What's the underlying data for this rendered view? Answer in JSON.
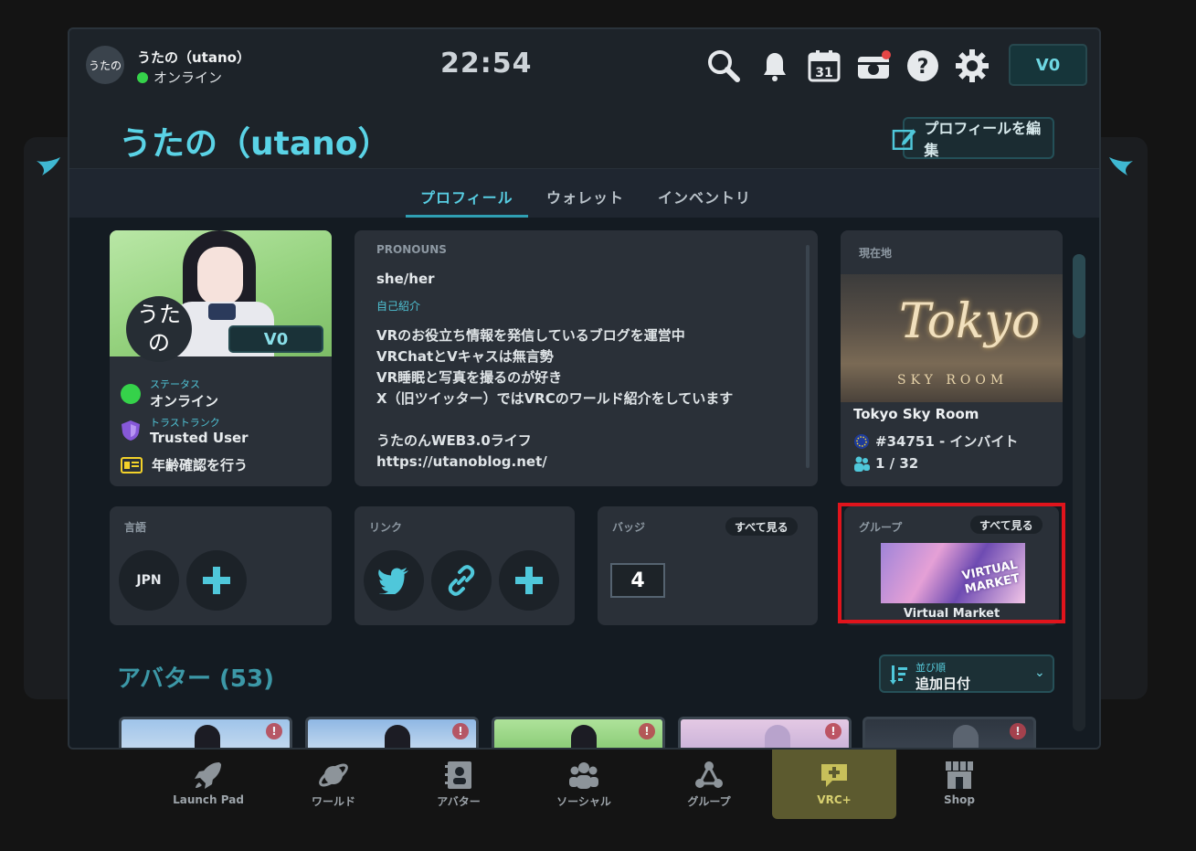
{
  "topbar": {
    "avatar_text": "うたの",
    "user_name": "うたの（utano）",
    "status": "オンライン",
    "clock": "22:54",
    "wallet": "V0",
    "calendar_day": "31"
  },
  "page": {
    "title": "うたの（utano）",
    "edit_label": "プロフィールを編集",
    "tabs": [
      "プロフィール",
      "ウォレット",
      "インベントリ"
    ]
  },
  "profile_card": {
    "avatar_text": "うた\nの",
    "vbadge": "V0",
    "status_label": "ステータス",
    "status_value": "オンライン",
    "trust_label": "トラストランク",
    "trust_value": "Trusted User",
    "age_verify": "年齢確認を行う"
  },
  "bio": {
    "pronouns_label": "PRONOUNS",
    "pronouns": "she/her",
    "intro_label": "自己紹介",
    "lines": [
      "VRのお役立ち情報を発信しているブログを運営中",
      "VRChatとVキャスは無言勢",
      "VR睡眠と写真を撮るのが好き",
      "X（旧ツイッター）ではVRCのワールド紹介をしています",
      "",
      "うたのんWEB3.0ライフ",
      "https://utanoblog.net/"
    ]
  },
  "location": {
    "label": "現在地",
    "world_title_1": "Tokyo",
    "world_title_2": "SKY ROOM",
    "world_name": "Tokyo Sky Room",
    "instance": "#34751 - インバイト",
    "players": "1 / 32"
  },
  "language": {
    "label": "言語",
    "code": "JPN"
  },
  "links": {
    "label": "リンク"
  },
  "badges": {
    "label": "バッジ",
    "see_all": "すべて見る",
    "count": "4"
  },
  "groups": {
    "label": "グループ",
    "see_all": "すべて見る",
    "banner_text": "VIRTUAL MARKET",
    "name": "Virtual Market"
  },
  "avatars": {
    "title": "アバター (53)",
    "sort_label": "並び順",
    "sort_value": "追加日付"
  },
  "bottom_nav": {
    "items": [
      "Launch Pad",
      "ワールド",
      "アバター",
      "ソーシャル",
      "グループ",
      "VRC+",
      "Shop"
    ],
    "active": "VRC+"
  },
  "colors": {
    "accent": "#57cde2",
    "online": "#35d24a",
    "highlight": "#e0141c",
    "vrcplus": "#d8d070"
  }
}
